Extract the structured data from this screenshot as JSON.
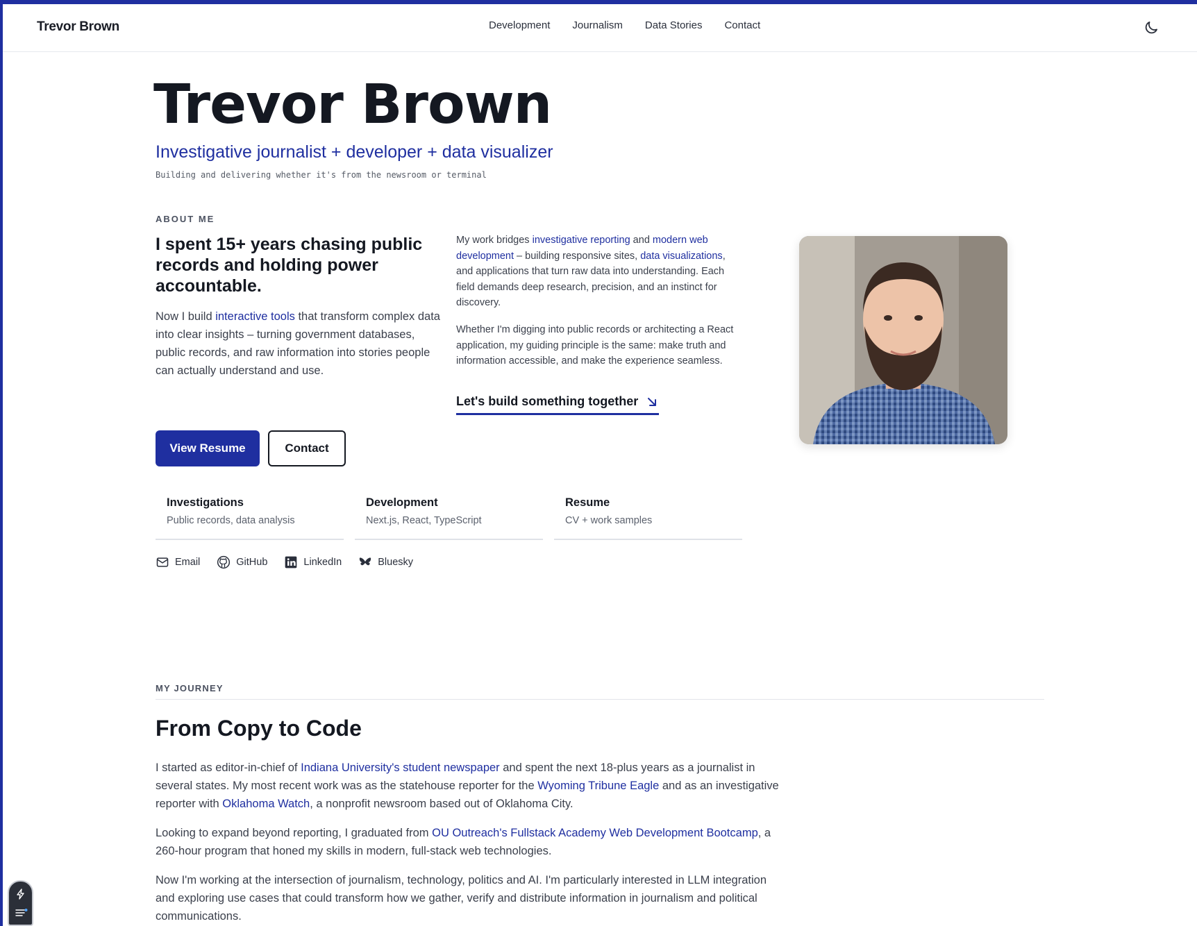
{
  "header": {
    "brand": "Trevor Brown",
    "nav": [
      "Development",
      "Journalism",
      "Data Stories",
      "Contact"
    ],
    "theme_toggle_icon": "moon-icon"
  },
  "hero": {
    "name": "Trevor Brown",
    "tagline": "Investigative journalist + developer + data visualizer",
    "mono": "Building and delivering whether it's from the newsroom or terminal"
  },
  "about": {
    "kicker": "ABOUT ME",
    "heading": "I spent 15+ years chasing public records and holding power accountable.",
    "lead": {
      "pre": "Now I build ",
      "link": "interactive tools",
      "post": " that transform complex data into clear insights – turning government databases, public records, and raw information into stories people can actually understand and use."
    },
    "p1": {
      "a": "My work bridges ",
      "link1": "investigative reporting",
      "b": " and ",
      "link2": "modern web development",
      "c": " – building responsive sites, ",
      "link3": "data visualizations",
      "d": ", and applications that turn raw data into understanding. Each field demands deep research, precision, and an instinct for discovery."
    },
    "p2": "Whether I'm digging into public records or architecting a React application, my guiding principle is the same: make truth and information accessible, and make the experience seamless.",
    "cta": "Let's build something together"
  },
  "buttons": {
    "resume": "View Resume",
    "contact": "Contact"
  },
  "cards": [
    {
      "title": "Investigations",
      "sub": "Public records, data analysis"
    },
    {
      "title": "Development",
      "sub": "Next.js, React, TypeScript"
    },
    {
      "title": "Resume",
      "sub": "CV + work samples"
    }
  ],
  "socials": [
    {
      "label": "Email",
      "icon": "mail-icon"
    },
    {
      "label": "GitHub",
      "icon": "github-icon"
    },
    {
      "label": "LinkedIn",
      "icon": "linkedin-icon"
    },
    {
      "label": "Bluesky",
      "icon": "bluesky-icon"
    }
  ],
  "journey": {
    "kicker": "MY JOURNEY",
    "heading": "From Copy to Code",
    "p1": {
      "a": "I started as editor-in-chief of ",
      "link1": "Indiana University's student newspaper",
      "b": " and spent the next 18-plus years as a journalist in several states. My most recent work was as the statehouse reporter for the ",
      "link2": "Wyoming Tribune Eagle",
      "c": " and as an investigative reporter with ",
      "link3": "Oklahoma Watch",
      "d": ", a nonprofit newsroom based out of Oklahoma City."
    },
    "p2": {
      "a": "Looking to expand beyond reporting, I graduated from ",
      "link": "OU Outreach's Fullstack Academy Web Development Bootcamp",
      "b": ", a 260-hour program that honed my skills in modern, full-stack web technologies."
    },
    "p3": "Now I'm working at the intersection of journalism, technology, politics and AI. I'm particularly interested in LLM integration and exploring use cases that could transform how we gather, verify and distribute information in journalism and political communications."
  },
  "colors": {
    "accent": "#1f2fa0",
    "text": "#141821"
  }
}
